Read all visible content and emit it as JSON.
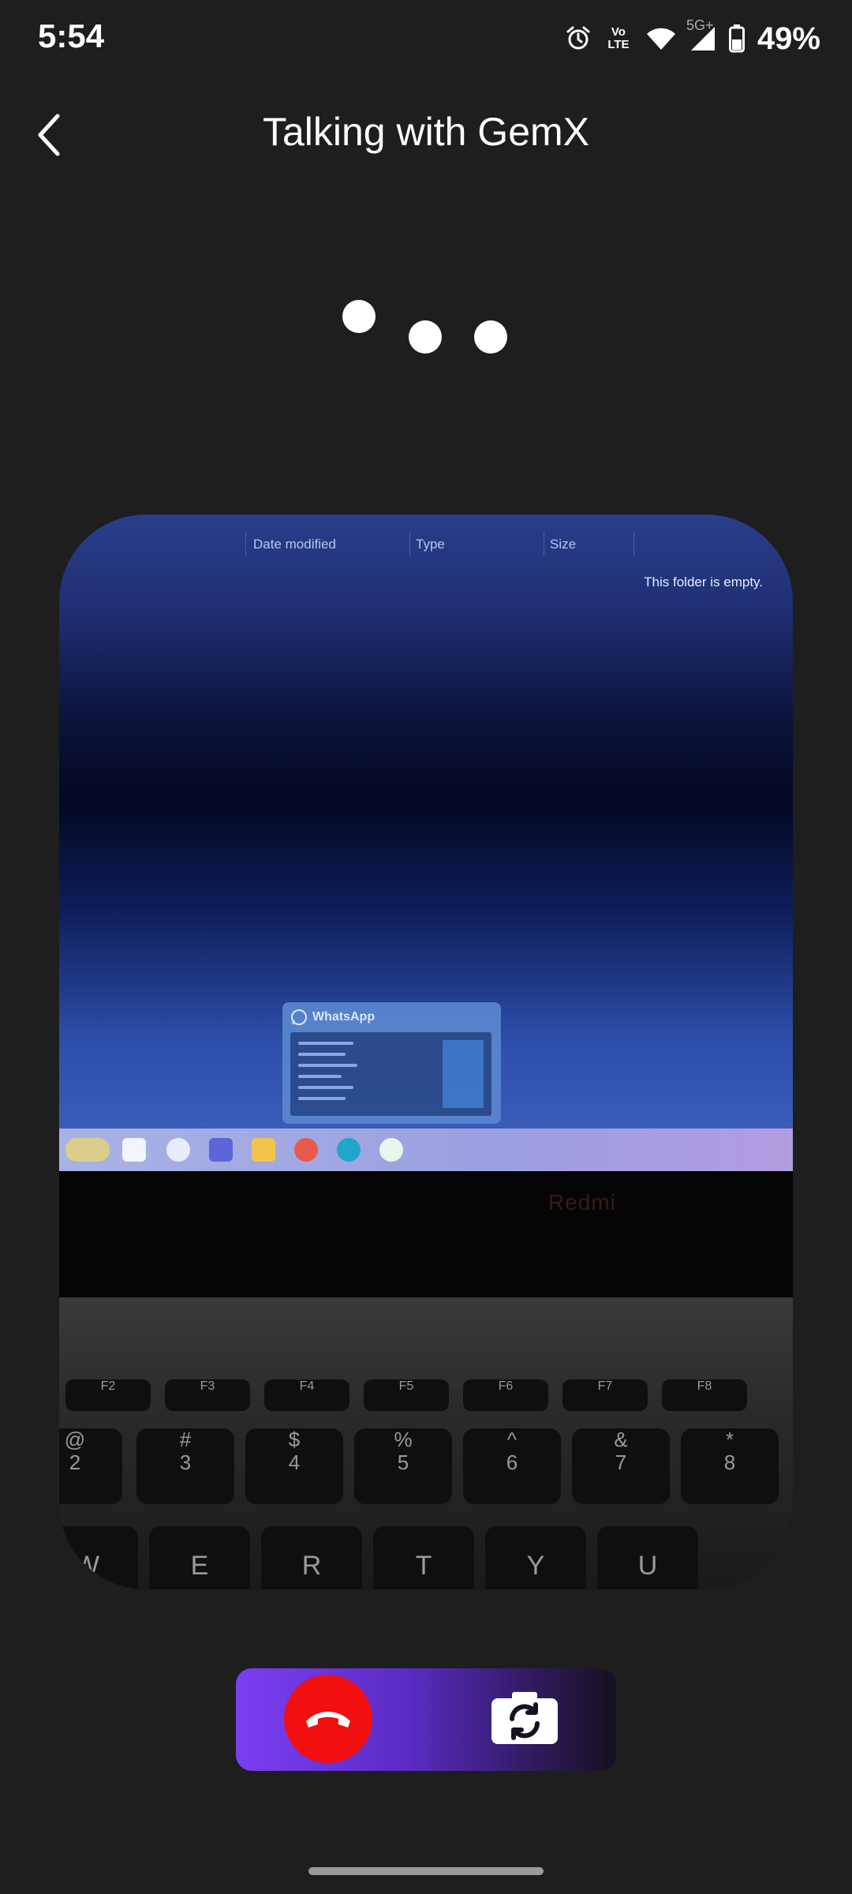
{
  "status_bar": {
    "time": "5:54",
    "volte_label": "Vo LTE",
    "network_label": "5G+",
    "battery_percent": "49%",
    "icons": [
      "alarm-icon",
      "volte-icon",
      "wifi-icon",
      "signal-icon",
      "battery-icon"
    ]
  },
  "header": {
    "title": "Talking with GemX",
    "back_icon": "chevron-left-icon"
  },
  "typing_indicator": {
    "dots": 3
  },
  "camera_preview": {
    "explorer_columns": [
      "Date modified",
      "Type",
      "Size"
    ],
    "empty_message": "This folder is empty.",
    "taskbar_preview_title": "WhatsApp",
    "laptop_brand": "Redmi",
    "function_keys": [
      "F2",
      "F3",
      "F4",
      "F5",
      "F6",
      "F7",
      "F8"
    ],
    "number_keys": [
      {
        "top": "@",
        "bottom": "2"
      },
      {
        "top": "#",
        "bottom": "3"
      },
      {
        "top": "$",
        "bottom": "4"
      },
      {
        "top": "%",
        "bottom": "5"
      },
      {
        "top": "^",
        "bottom": "6"
      },
      {
        "top": "&",
        "bottom": "7"
      },
      {
        "top": "*",
        "bottom": "8"
      }
    ],
    "letter_keys": [
      "W",
      "E",
      "R",
      "T",
      "Y",
      "U"
    ]
  },
  "controls": {
    "end_call_icon": "phone-hangup-icon",
    "switch_camera_icon": "camera-switch-icon",
    "colors": {
      "end_call": "#f20f0f",
      "panel_start": "#7b3ff2",
      "panel_end": "#15101e"
    }
  }
}
